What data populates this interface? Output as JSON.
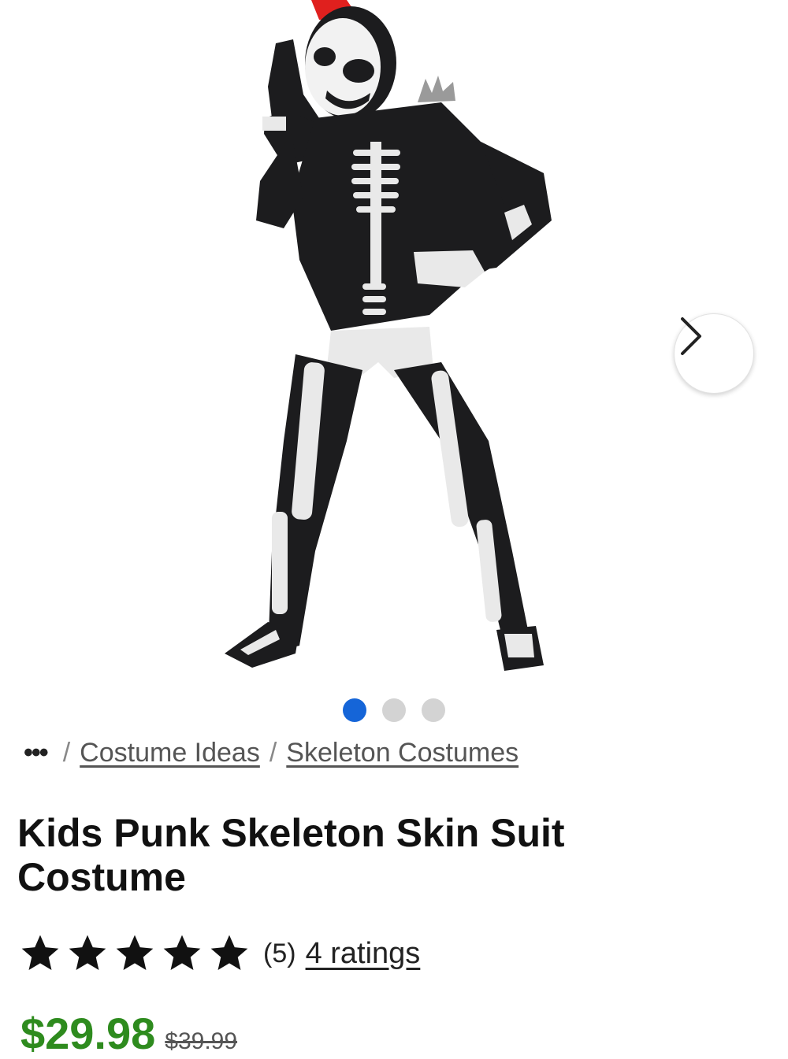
{
  "product_image": {
    "alt": "Kids Punk Skeleton Skin Suit Costume"
  },
  "carousel": {
    "total": 3,
    "active_index": 0
  },
  "breadcrumb": {
    "more_label": "•••",
    "separator": "/",
    "items": [
      {
        "label": "Costume Ideas"
      },
      {
        "label": "Skeleton Costumes"
      }
    ]
  },
  "product": {
    "title": "Kids Punk Skeleton Skin Suit Costume",
    "rating": {
      "stars": 5,
      "max": 5,
      "count_label": "(5)",
      "ratings_link": "4 ratings"
    },
    "price": "$29.98",
    "original_price": "$39.99"
  },
  "colors": {
    "accent": "#1565d8",
    "price": "#2e8b1e",
    "mohawk": "#e0201e",
    "suit": "#1c1c1e"
  },
  "icons": {
    "next": "chevron-right-icon",
    "star": "star-icon"
  }
}
